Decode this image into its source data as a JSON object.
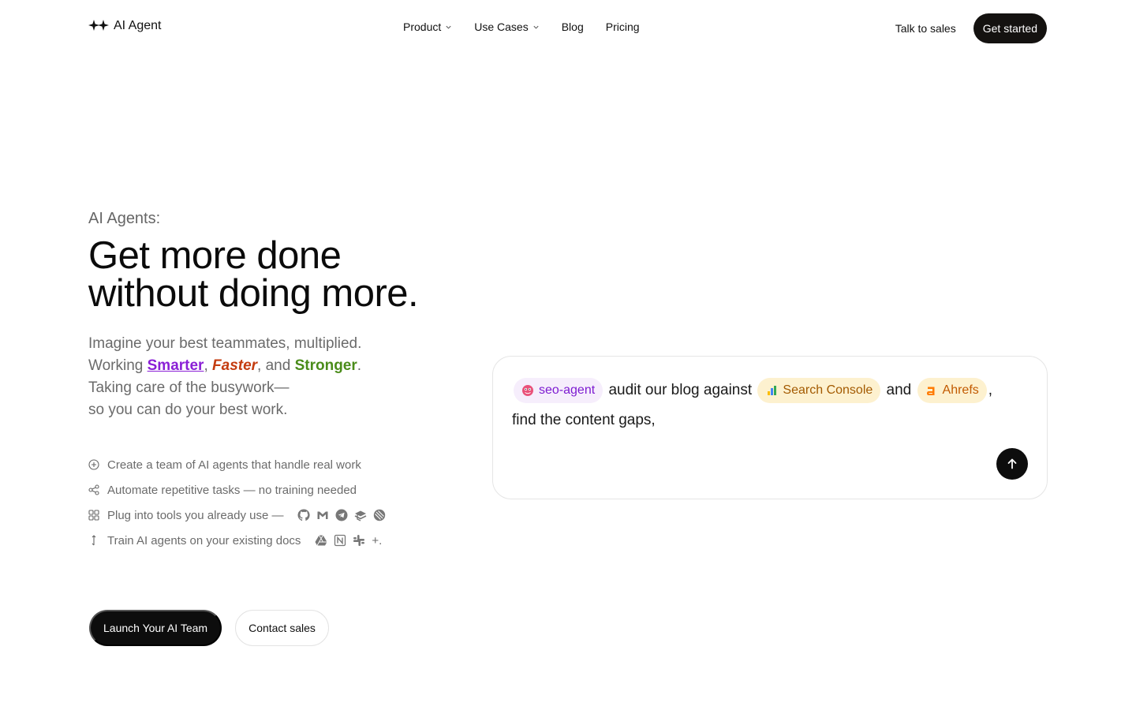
{
  "header": {
    "brand": {
      "name": "AI Agent",
      "icon": "sparkles-icon"
    },
    "nav": [
      {
        "label": "Product",
        "has_dropdown": true
      },
      {
        "label": "Use Cases",
        "has_dropdown": true
      },
      {
        "label": "Blog",
        "has_dropdown": false
      },
      {
        "label": "Pricing",
        "has_dropdown": false
      }
    ],
    "talk_to_sales": "Talk to sales",
    "get_started": "Get started"
  },
  "hero": {
    "eyebrow": "AI Agents:",
    "headline_line1": "Get more done",
    "headline_line2": "without doing more.",
    "lede_line1": "Imagine your best teammates, multiplied.",
    "working_prefix": "Working ",
    "smarter": "Smarter",
    "sep1": ", ",
    "faster": "Faster",
    "sep2": ", and ",
    "stronger": "Stronger",
    "period": ".",
    "lede_line3": "Taking care of the busywork—",
    "lede_line4": "so you can do your best work.",
    "features": [
      {
        "icon": "plus-circle-icon",
        "text": "Create a team of AI agents that handle real work"
      },
      {
        "icon": "share-nodes-icon",
        "text": "Automate repetitive tasks — no training needed"
      },
      {
        "icon": "grid-icon",
        "text": "Plug into tools you already use —"
      },
      {
        "icon": "arrow-vertical-icon",
        "text": "Train AI agents on your existing docs"
      }
    ],
    "tools_icons": [
      "github-icon",
      "gmail-icon",
      "telegram-icon",
      "stack-icon",
      "linear-icon"
    ],
    "docs_icons": [
      "google-drive-icon",
      "notion-icon",
      "slack-icon"
    ],
    "docs_more": "+.",
    "launch_button": "Launch Your AI Team",
    "contact_button": "Contact sales"
  },
  "prompt_card": {
    "agent_chip": "seo-agent",
    "text1": "audit our blog against",
    "chip_search_console": "Search Console",
    "text2": "and",
    "chip_ahrefs": "Ahrefs",
    "text3": ",",
    "text4": "find the content gaps,",
    "send_icon": "arrow-up-icon"
  },
  "colors": {
    "accent_purple": "#8a1fd6",
    "accent_orange": "#c43c10",
    "accent_green": "#4a8c1a",
    "button_dark": "#0d0d0d"
  }
}
